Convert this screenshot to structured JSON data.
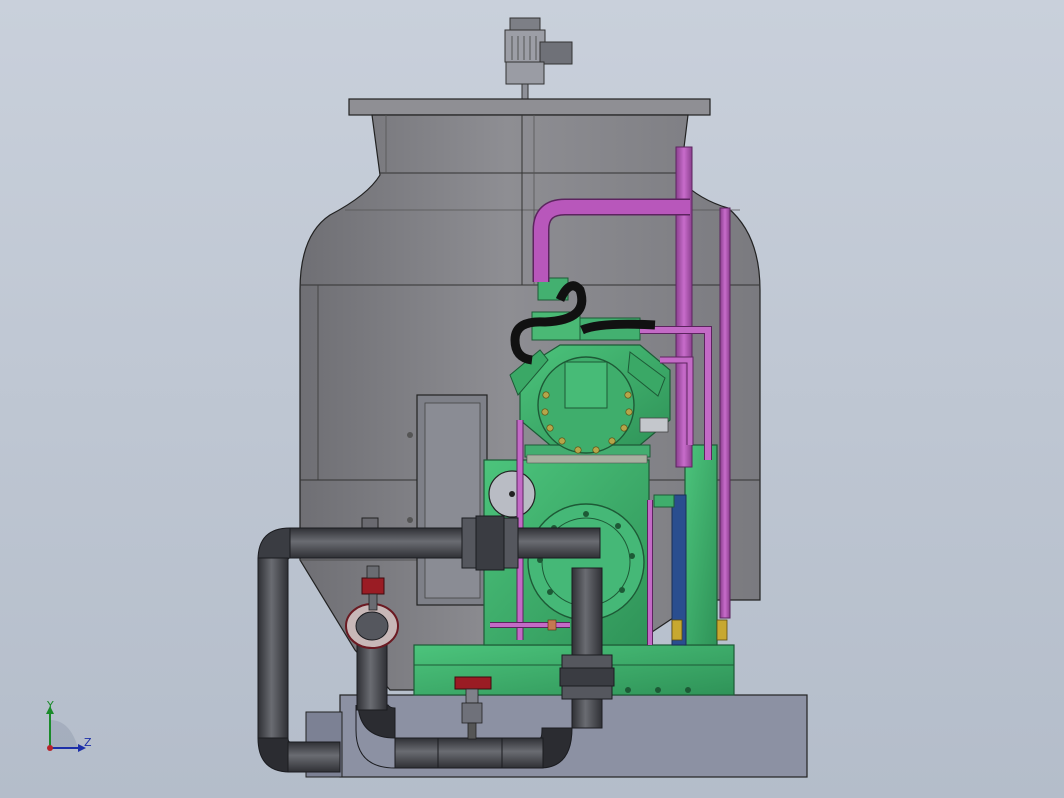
{
  "viewport": {
    "background_top": "#c9d0db",
    "background_bottom": "#b4bdca"
  },
  "colors": {
    "tower_shell": "#8a8a8f",
    "tower_shell_dark": "#6d6d72",
    "compressor_green": "#3fb46e",
    "compressor_green_dark": "#2e8f55",
    "refrigerant_pipe": "#b54fb8",
    "water_pipe": "#4a4c52",
    "base_plate": "#8c91a3",
    "valve_red": "#9a1c24"
  },
  "triad": {
    "y_label": "Y",
    "z_label": "Z",
    "y_color": "#1a8a2a",
    "z_color": "#1c2fa8"
  }
}
